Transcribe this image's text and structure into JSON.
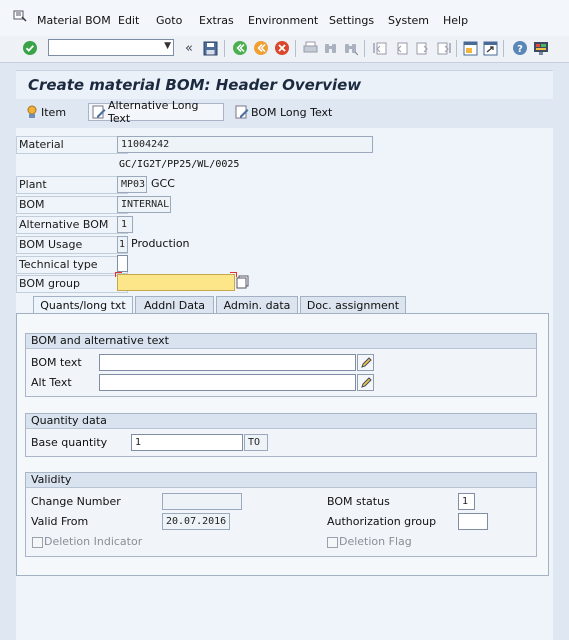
{
  "menubar": {
    "items": [
      "Material BOM",
      "Edit",
      "Goto",
      "Extras",
      "Environment",
      "Settings",
      "System",
      "Help"
    ]
  },
  "toolbar": {
    "command_field": "",
    "icons": [
      "enter-icon",
      "save-icon",
      "back-icon",
      "exit-icon",
      "cancel-icon",
      "print-icon",
      "find-icon",
      "find-next-icon",
      "first-page-icon",
      "previous-page-icon",
      "next-page-icon",
      "last-page-icon",
      "new-session-icon",
      "shortcut-icon",
      "help-icon",
      "customize-layout-icon"
    ]
  },
  "header": {
    "title": "Create material BOM: Header Overview"
  },
  "app_toolbar": {
    "item_label": "Item",
    "alt_long_text_label": "Alternative Long Text",
    "bom_long_text_label": "BOM Long Text"
  },
  "fields": {
    "material_label": "Material",
    "material_value": "11004242",
    "material_desc": "GC/IG2T/PP25/WL/0025",
    "plant_label": "Plant",
    "plant_value": "MP03",
    "plant_desc": "GCC",
    "bom_label": "BOM",
    "bom_value": "INTERNAL",
    "alt_bom_label": "Alternative BOM",
    "alt_bom_value": "1",
    "bom_usage_label": "BOM Usage",
    "bom_usage_value": "1",
    "bom_usage_desc": "Production",
    "tech_type_label": "Technical type",
    "tech_type_value": "",
    "bom_group_label": "BOM group",
    "bom_group_value": ""
  },
  "tabs": [
    "Quants/long txt",
    "Addnl Data",
    "Admin. data",
    "Doc. assignment"
  ],
  "bom_text_group": {
    "title": "BOM and alternative text",
    "bom_text_label": "BOM text",
    "bom_text_value": "",
    "alt_text_label": "Alt Text",
    "alt_text_value": ""
  },
  "quantity_group": {
    "title": "Quantity data",
    "base_qty_label": "Base quantity",
    "base_qty_value": "1",
    "unit_value": "TO"
  },
  "validity_group": {
    "title": "Validity",
    "change_number_label": "Change Number",
    "change_number_value": "",
    "valid_from_label": "Valid From",
    "valid_from_value": "20.07.2016",
    "deletion_indicator_label": "Deletion Indicator",
    "bom_status_label": "BOM status",
    "bom_status_value": "1",
    "auth_group_label": "Authorization group",
    "auth_group_value": "",
    "deletion_flag_label": "Deletion Flag"
  },
  "colors": {
    "background": "#dfe7f2",
    "required_field": "#fde68a",
    "enter_icon_green": "#3aa34a",
    "back_icon_green": "#4caf50",
    "exit_icon_orange": "#f0a030",
    "cancel_icon_red": "#d9482b"
  }
}
